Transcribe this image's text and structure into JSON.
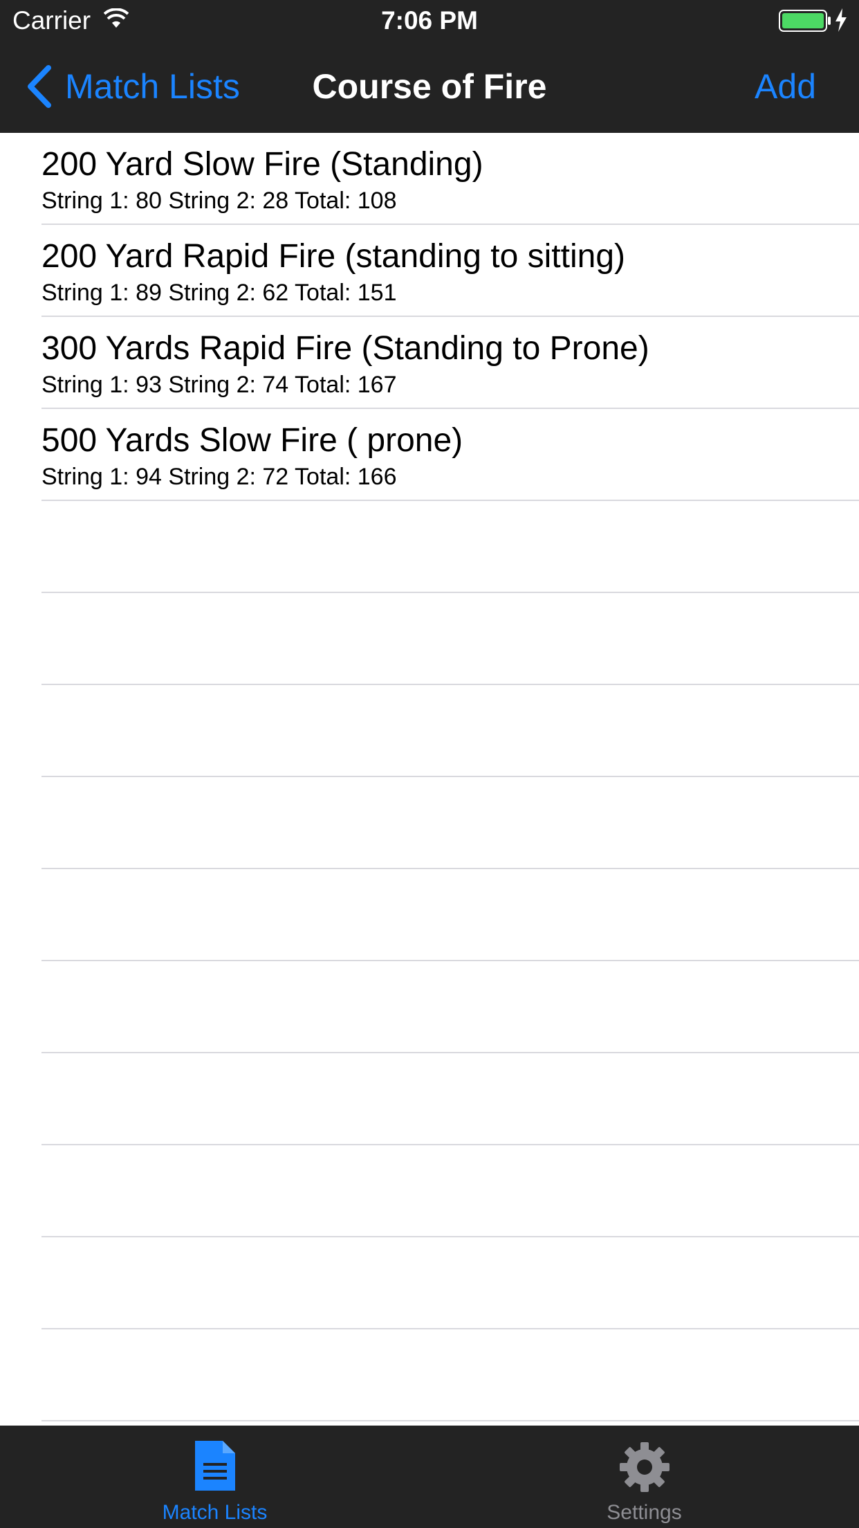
{
  "status_bar": {
    "carrier": "Carrier",
    "time": "7:06 PM",
    "battery_color": "#4cd964"
  },
  "nav_bar": {
    "back_label": "Match Lists",
    "title": "Course of Fire",
    "add_label": "Add",
    "accent_color": "#1b84ff"
  },
  "courses": [
    {
      "title": "200 Yard Slow Fire (Standing)",
      "subtitle": "String 1: 80 String 2: 28 Total: 108"
    },
    {
      "title": "200 Yard Rapid Fire (standing to sitting)",
      "subtitle": "String 1: 89 String 2: 62 Total: 151"
    },
    {
      "title": "300 Yards Rapid Fire (Standing to Prone)",
      "subtitle": "String 1: 93 String 2: 74 Total: 167"
    },
    {
      "title": "500 Yards Slow Fire ( prone)",
      "subtitle": "String 1: 94 String 2: 72 Total: 166"
    }
  ],
  "tab_bar": {
    "tabs": [
      {
        "label": "Match Lists",
        "icon": "document-icon",
        "selected": true
      },
      {
        "label": "Settings",
        "icon": "gear-icon",
        "selected": false
      }
    ],
    "selected_color": "#1b84ff",
    "unselected_color": "#8e8e93"
  }
}
